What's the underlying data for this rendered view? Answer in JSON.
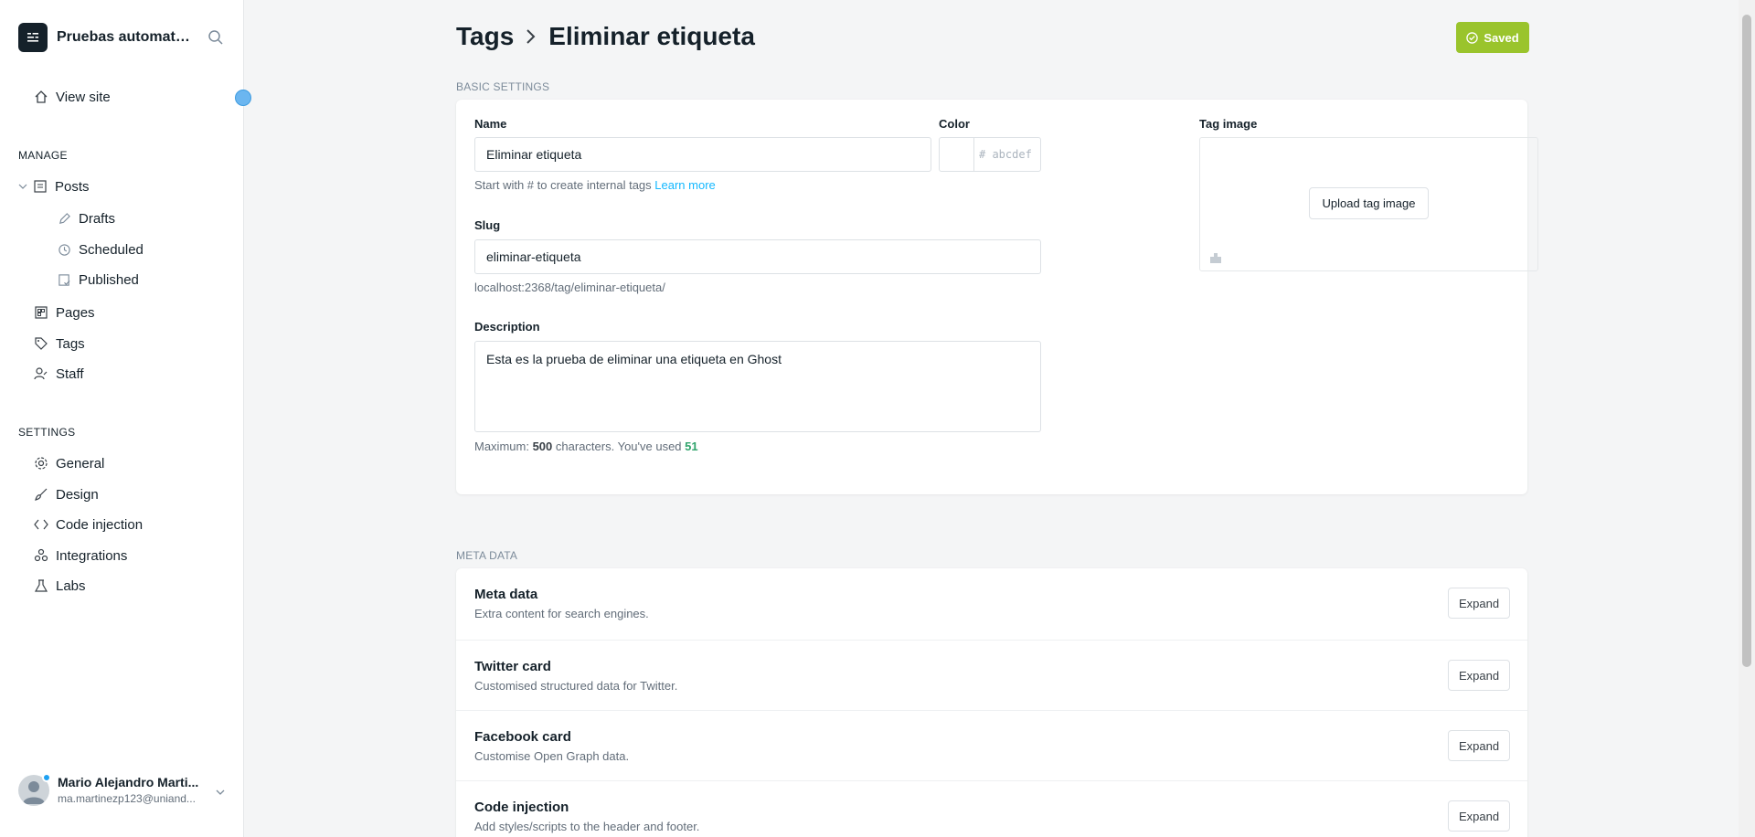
{
  "sidebar": {
    "site_title": "Pruebas automatiz...",
    "view_site": "View site",
    "manage_label": "MANAGE",
    "settings_label": "SETTINGS",
    "manage_items": {
      "posts": "Posts",
      "drafts": "Drafts",
      "scheduled": "Scheduled",
      "published": "Published",
      "pages": "Pages",
      "tags": "Tags",
      "staff": "Staff"
    },
    "settings_items": {
      "general": "General",
      "design": "Design",
      "code_injection": "Code injection",
      "integrations": "Integrations",
      "labs": "Labs"
    },
    "user": {
      "name": "Mario Alejandro Marti...",
      "email": "ma.martinezp123@uniand..."
    }
  },
  "header": {
    "breadcrumb_parent": "Tags",
    "breadcrumb_current": "Eliminar etiqueta",
    "saved_label": "Saved"
  },
  "basic": {
    "section_title": "BASIC SETTINGS",
    "name_label": "Name",
    "name_value": "Eliminar etiqueta",
    "name_hint": "Start with # to create internal tags",
    "learn_more": "Learn more",
    "color_label": "Color",
    "color_placeholder": "# abcdef",
    "slug_label": "Slug",
    "slug_value": "eliminar-etiqueta",
    "slug_url": "localhost:2368/tag/eliminar-etiqueta/",
    "description_label": "Description",
    "description_value": "Esta es la prueba de eliminar una etiqueta en Ghost",
    "max_prefix": "Maximum:",
    "max_chars": "500",
    "used_text": "characters. You've used",
    "used_count": "51",
    "tag_image_label": "Tag image",
    "upload_label": "Upload tag image"
  },
  "meta": {
    "section_title": "META DATA",
    "rows": [
      {
        "title": "Meta data",
        "subtitle": "Extra content for search engines.",
        "button": "Expand"
      },
      {
        "title": "Twitter card",
        "subtitle": "Customised structured data for Twitter.",
        "button": "Expand"
      },
      {
        "title": "Facebook card",
        "subtitle": "Customise Open Graph data.",
        "button": "Expand"
      },
      {
        "title": "Code injection",
        "subtitle": "Add styles/scripts to the header and footer.",
        "button": "Expand"
      }
    ]
  },
  "colors": {
    "saved_green": "#9ac42c",
    "link_blue": "#14b8ff",
    "used_green": "#30a46c"
  }
}
